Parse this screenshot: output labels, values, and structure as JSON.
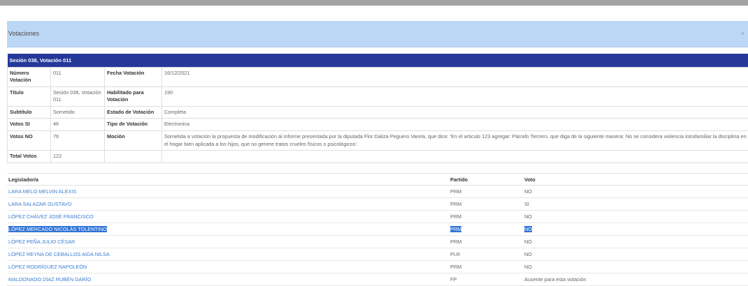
{
  "modal": {
    "title": "Votaciones",
    "close": "×"
  },
  "session": {
    "header": "Sesión 038, Votación 011",
    "rows": [
      {
        "l1": "Número Votación",
        "v1": "011",
        "l2": "Fecha Votación",
        "v2": "16/12/2021"
      },
      {
        "l1": "Título",
        "v1": "Sesión 038, Votación 011",
        "l2": "Habilitado para Votación",
        "v2": "190"
      },
      {
        "l1": "Subtitulo",
        "v1": "Sometido",
        "l2": "Estado de Votación",
        "v2": "Completa"
      },
      {
        "l1": "Votos SI",
        "v1": "46",
        "l2": "Tipo de Votación",
        "v2": "Electronica"
      },
      {
        "l1": "Votos NO",
        "v1": "76",
        "l2": "Moción",
        "v2": "Sometida a votación la propuesta de modificación al informe presentada por la diputada Flor Daliza Peguero Varela, que dice: 'En el articulo 123 agregar: Párrafo Tercero, que diga de la siguiente manera: No se considera violencia intrafamiliar la disciplina en el hogar bien aplicada a los hijos, que no genere tratos crueles físicos o psicológicos'."
      },
      {
        "l1": "Total Votos",
        "v1": "122",
        "l2": "",
        "v2": ""
      }
    ]
  },
  "legislators": {
    "headers": {
      "name": "Legislador/a",
      "party": "Partido",
      "vote": "Voto"
    },
    "rows": [
      {
        "name": "LARA MELO MELVIN ALEXIS",
        "party": "PRM",
        "vote": "NO"
      },
      {
        "name": "LARA SALAZAR GUSTAVO",
        "party": "PRM",
        "vote": "SI"
      },
      {
        "name": "LÓPEZ CHÁVEZ JOSÉ FRANCISCO",
        "party": "PRM",
        "vote": "NO"
      },
      {
        "name": "LÓPEZ MERCADO NICOLÁS TOLENTINO",
        "party": "PRM",
        "vote": "NO"
      },
      {
        "name": "LÓPEZ PEÑA JULIO CÉSAR",
        "party": "PRM",
        "vote": "NO"
      },
      {
        "name": "LÓPEZ REYNA DE CEBALLOS AIDA NILSA",
        "party": "PLR",
        "vote": "NO"
      },
      {
        "name": "LÓPEZ RODRÍGUEZ NAPOLEÓN",
        "party": "PRM",
        "vote": "NO"
      },
      {
        "name": "MALDONADO DÍAZ RUBÉN DARÍO",
        "party": "FP",
        "vote": "Ausente para esta votación"
      }
    ]
  }
}
